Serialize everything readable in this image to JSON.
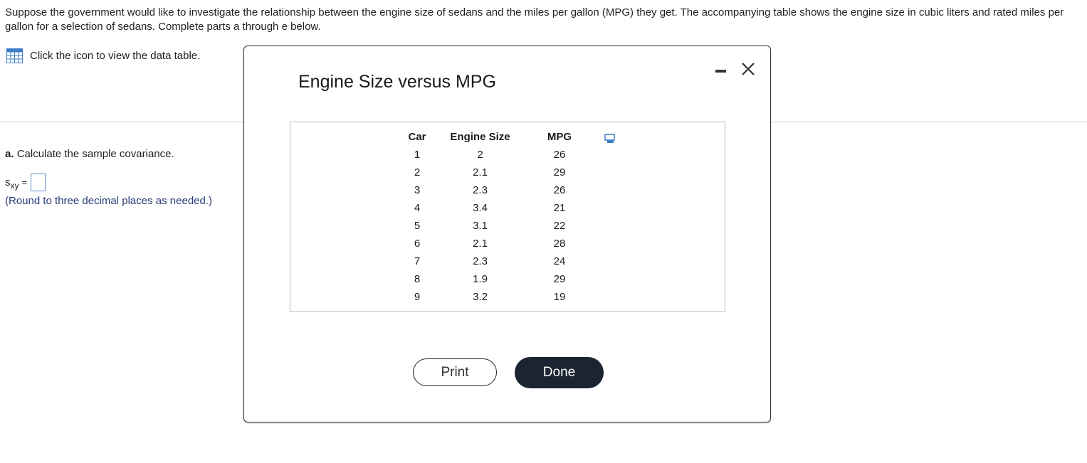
{
  "question": {
    "text": "Suppose the government would like to investigate the relationship between the engine size of sedans and the miles per gallon (MPG) they get. The accompanying table shows the engine size in cubic liters and rated miles per gallon for a selection of sedans. Complete parts a through e below."
  },
  "data_link": {
    "icon": "table-icon",
    "label": "Click the icon to view the data table."
  },
  "part_a": {
    "letter": "a.",
    "prompt": "Calculate the sample covariance.",
    "var_main": "s",
    "var_sub": "xy",
    "equals": "=",
    "answer_value": "",
    "note": "(Round to three decimal places as needed.)"
  },
  "dialog": {
    "title": "Engine Size versus MPG",
    "minimize_icon": "minimize-icon",
    "close_icon": "close-icon",
    "table": {
      "headers": [
        "Car",
        "Engine Size",
        "MPG"
      ],
      "rows": [
        [
          "1",
          "2",
          "26"
        ],
        [
          "2",
          "2.1",
          "29"
        ],
        [
          "3",
          "2.3",
          "26"
        ],
        [
          "4",
          "3.4",
          "21"
        ],
        [
          "5",
          "3.1",
          "22"
        ],
        [
          "6",
          "2.1",
          "28"
        ],
        [
          "7",
          "2.3",
          "24"
        ],
        [
          "8",
          "1.9",
          "29"
        ],
        [
          "9",
          "3.2",
          "19"
        ]
      ],
      "copy_icon": "copy-icon"
    },
    "print_label": "Print",
    "done_label": "Done"
  },
  "colors": {
    "accent_blue": "#3d7cc9",
    "note_text": "#2a3b7a",
    "done_button_bg": "#1b2432"
  }
}
